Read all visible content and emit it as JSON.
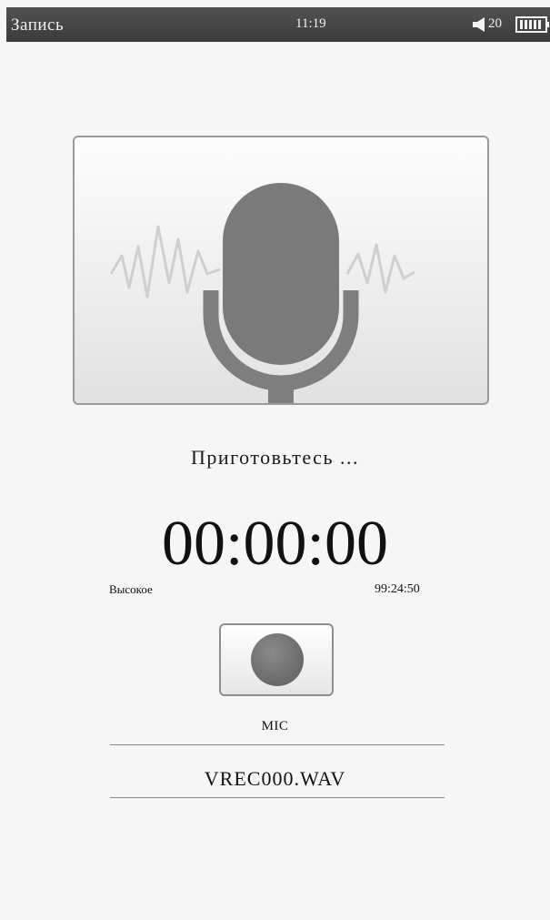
{
  "status_bar": {
    "title": "Запись",
    "time": "11:19",
    "volume": "20",
    "volume_icon": "speaker-icon",
    "battery_icon": "battery-icon"
  },
  "illustration": {
    "icon": "microphone-icon"
  },
  "recorder": {
    "message": "Приготовьтесь ...",
    "elapsed": "00:00:00",
    "quality": "Высокое",
    "remaining": "99:24:50",
    "record_icon": "record-icon",
    "source": "MIC",
    "file_name": "VREC000.WAV"
  },
  "colors": {
    "status_bar": "#474747",
    "background": "#f6f6f6",
    "mic": "#7a7a7a",
    "record_dot": "#707070"
  }
}
